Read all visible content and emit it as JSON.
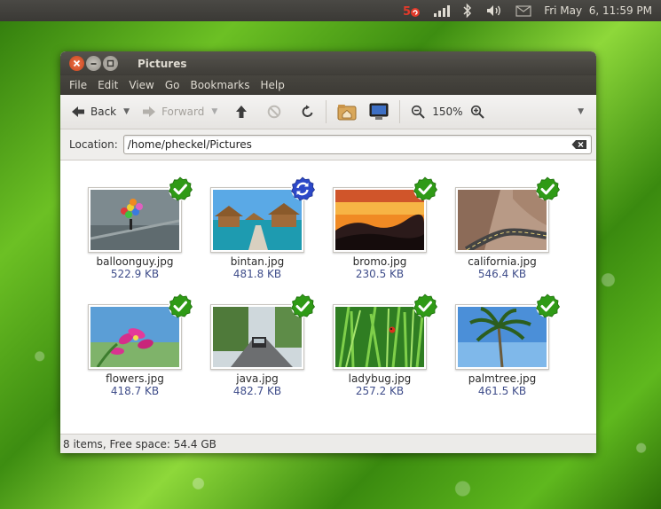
{
  "panel": {
    "clock": "Fri May  6, 11:59 PM"
  },
  "window": {
    "title": "Pictures"
  },
  "menu": [
    "File",
    "Edit",
    "View",
    "Go",
    "Bookmarks",
    "Help"
  ],
  "toolbar": {
    "back_label": "Back",
    "forward_label": "Forward",
    "zoom_level": "150%"
  },
  "location": {
    "label": "Location:",
    "value": "/home/pheckel/Pictures"
  },
  "files": [
    {
      "name": "balloonguy.jpg",
      "size": "522.9 KB",
      "emblem": "check-emblem-icon"
    },
    {
      "name": "bintan.jpg",
      "size": "481.8 KB",
      "emblem": "sync-emblem-icon"
    },
    {
      "name": "bromo.jpg",
      "size": "230.5 KB",
      "emblem": "check-emblem-icon"
    },
    {
      "name": "california.jpg",
      "size": "546.4 KB",
      "emblem": "check-emblem-icon"
    },
    {
      "name": "flowers.jpg",
      "size": "418.7 KB",
      "emblem": "check-emblem-icon"
    },
    {
      "name": "java.jpg",
      "size": "482.7 KB",
      "emblem": "check-emblem-icon"
    },
    {
      "name": "ladybug.jpg",
      "size": "257.2 KB",
      "emblem": "check-emblem-icon"
    },
    {
      "name": "palmtree.jpg",
      "size": "461.5 KB",
      "emblem": "check-emblem-icon"
    }
  ],
  "status": {
    "text": "8 items, Free space: 54.4 GB"
  },
  "colors": {
    "sync_ok": "#2f9a16",
    "syncing": "#2c48c8",
    "size_text": "#3f4d8a"
  }
}
